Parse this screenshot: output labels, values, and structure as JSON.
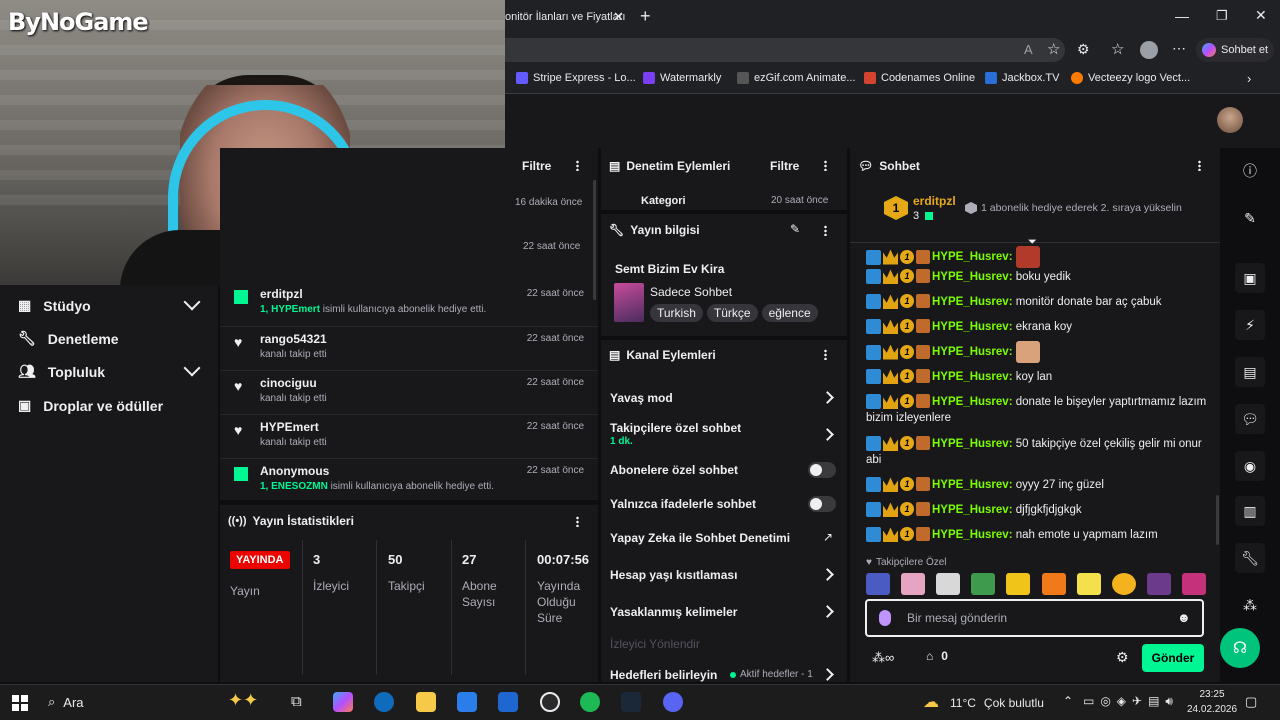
{
  "overlay": {
    "logo": "ByNoGame"
  },
  "browser": {
    "tab_title": "onitör İlanları ve Fiyatları",
    "sidebar_button": "Sohbet et",
    "bookmarks": [
      "Stripe Express - Lo...",
      "Watermarkly",
      "ezGif.com Animate...",
      "Codenames Online",
      "Jackbox.TV",
      "Vecteezy logo Vect..."
    ]
  },
  "leftnav": {
    "items": [
      {
        "label": "Stüdyo",
        "icon": "studio-icon",
        "expandable": true
      },
      {
        "label": "Denetleme",
        "icon": "wrench-icon",
        "expandable": false
      },
      {
        "label": "Topluluk",
        "icon": "community-icon",
        "expandable": true
      },
      {
        "label": "Droplar ve ödüller",
        "icon": "gift-icon",
        "expandable": false
      }
    ]
  },
  "activity": {
    "filter_label": "Filtre",
    "rows": [
      {
        "name": "",
        "sub": "",
        "time": "16 dakika önce"
      },
      {
        "name": "",
        "sub": "",
        "time": "22 saat önce"
      },
      {
        "name": "erditpzl",
        "sub_prefix": "1, HYPEmert",
        "sub": " isimli kullanıcıya abonelik hediye etti.",
        "time": "22 saat önce",
        "icon": "gift"
      },
      {
        "name": "rango54321",
        "sub": "kanalı takip etti",
        "time": "22 saat önce",
        "icon": "heart"
      },
      {
        "name": "cinociguu",
        "sub": "kanalı takip etti",
        "time": "22 saat önce",
        "icon": "heart"
      },
      {
        "name": "HYPEmert",
        "sub": "kanalı takip etti",
        "time": "22 saat önce",
        "icon": "heart"
      },
      {
        "name": "Anonymous",
        "sub_prefix": "1, ENESOZMN",
        "sub": " isimli kullanıcıya abonelik hediye etti.",
        "time": "22 saat önce",
        "icon": "gift"
      }
    ]
  },
  "stats": {
    "title": "Yayın İstatistikleri",
    "live_badge": "YAYINDA",
    "live_label": "Yayın",
    "viewers": "3",
    "viewers_label": "İzleyici",
    "followers": "50",
    "followers_label": "Takipçi",
    "subs": "27",
    "subs_label": "Abone Sayısı",
    "uptime": "00:07:56",
    "uptime_label": "Yayında Olduğu Süre"
  },
  "mod_actions": {
    "title": "Denetim Eylemleri",
    "filter": "Filtre",
    "partial_row": "Kategori",
    "partial_time": "20 saat önce"
  },
  "stream_info": {
    "title": "Yayın bilgisi",
    "stream_title": "Semt Bizim Ev Kira",
    "category": "Sadece Sohbet",
    "tags": [
      "Turkish",
      "Türkçe",
      "eğlence"
    ]
  },
  "channel_actions": {
    "title": "Kanal Eylemleri",
    "slow_mode": "Yavaş mod",
    "followers_only": "Takipçilere özel sohbet",
    "followers_only_value": "1 dk.",
    "subs_only": "Abonelere özel sohbet",
    "emote_only": "Yalnızca ifadelerle sohbet",
    "ai_mod": "Yapay Zeka ile Sohbet Denetimi",
    "account_age": "Hesap yaşı kısıtlaması",
    "banned_words": "Yasaklanmış kelimeler",
    "viewer_guide": "İzleyici Yönlendir",
    "goals": "Hedefleri belirleyin",
    "goals_status": "Aktif hedefler - 1"
  },
  "chat": {
    "title": "Sohbet",
    "gift_leader": "erditpzl",
    "gift_leader_count": "3",
    "gift_message": "1 abonelik hediye ederek 2. sıraya yükselin",
    "messages": [
      {
        "user": "HYPE_Husrev",
        "text": "",
        "emote": true
      },
      {
        "user": "HYPE_Husrev",
        "text": "boku yedik"
      },
      {
        "user": "HYPE_Husrev",
        "text": "monitör donate bar aç çabuk"
      },
      {
        "user": "HYPE_Husrev",
        "text": "ekrana koy"
      },
      {
        "user": "HYPE_Husrev",
        "text": "",
        "emote": true
      },
      {
        "user": "HYPE_Husrev",
        "text": "koy lan"
      },
      {
        "user": "HYPE_Husrev",
        "text": "donate le bişeyler yaptırtmamız lazım bizim izleyenlere"
      },
      {
        "user": "HYPE_Husrev",
        "text": "50 takipçiye özel çekiliş gelir mi onur abi"
      },
      {
        "user": "HYPE_Husrev",
        "text": "oyyy 27 inç güzel"
      },
      {
        "user": "HYPE_Husrev",
        "text": "djfjgkfjdjgkgk"
      },
      {
        "user": "HYPE_Husrev",
        "text": "nah emote u yapmam lazım"
      }
    ],
    "followers_emotes_label": "Takipçilere Özel",
    "input_placeholder": "Bir mesaj gönderin",
    "points": "0",
    "send": "Gönder"
  },
  "taskbar": {
    "search": "Ara",
    "weather": "11°C",
    "weather_desc": "Çok bulutlu",
    "time": "23:25",
    "date": "24.02.2026"
  },
  "colors": {
    "accent": "#00f593",
    "chat_name": "#7cfc00",
    "live": "#eb0400",
    "send": "#00f593"
  }
}
